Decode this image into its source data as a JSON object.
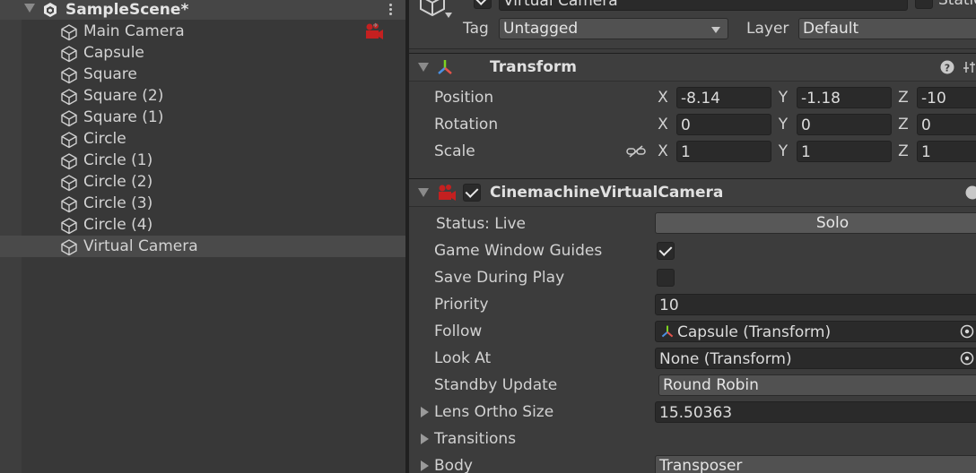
{
  "hierarchy": {
    "scene_name": "SampleScene*",
    "items": [
      {
        "label": "Main Camera",
        "icon": "cube-icon"
      },
      {
        "label": "Capsule",
        "icon": "cube-icon"
      },
      {
        "label": "Square",
        "icon": "cube-icon"
      },
      {
        "label": "Square (2)",
        "icon": "cube-icon"
      },
      {
        "label": "Square (1)",
        "icon": "cube-icon"
      },
      {
        "label": "Circle",
        "icon": "cube-icon"
      },
      {
        "label": "Circle (1)",
        "icon": "cube-icon"
      },
      {
        "label": "Circle (2)",
        "icon": "cube-icon"
      },
      {
        "label": "Circle (3)",
        "icon": "cube-icon"
      },
      {
        "label": "Circle (4)",
        "icon": "cube-icon"
      },
      {
        "label": "Virtual Camera",
        "icon": "cube-icon",
        "selected": true
      }
    ]
  },
  "inspector": {
    "object_name": "Virtual Camera",
    "static_label": "Static",
    "tag_label": "Tag",
    "tag_value": "Untagged",
    "layer_label": "Layer",
    "layer_value": "Default",
    "transform": {
      "title": "Transform",
      "position_label": "Position",
      "rotation_label": "Rotation",
      "scale_label": "Scale",
      "x": "X",
      "y": "Y",
      "z": "Z",
      "position": {
        "x": "-8.14",
        "y": "-1.18",
        "z": "-10"
      },
      "rotation": {
        "x": "0",
        "y": "0",
        "z": "0"
      },
      "scale": {
        "x": "1",
        "y": "1",
        "z": "1"
      }
    },
    "vcam": {
      "title": "CinemachineVirtualCamera",
      "status": "Status: Live",
      "solo": "Solo",
      "game_window_guides_label": "Game Window Guides",
      "game_window_guides": true,
      "save_during_play_label": "Save During Play",
      "save_during_play": false,
      "priority_label": "Priority",
      "priority": "10",
      "follow_label": "Follow",
      "follow": "Capsule (Transform)",
      "look_at_label": "Look At",
      "look_at": "None (Transform)",
      "standby_label": "Standby Update",
      "standby": "Round Robin",
      "lens_label": "Lens Ortho Size",
      "lens": "15.50363",
      "transitions_label": "Transitions",
      "body_label": "Body",
      "body": "Transposer"
    }
  },
  "colors": {
    "panel": "#383838",
    "inspector": "#3c3c3c",
    "field": "#2a2a2a",
    "camera_badge": "#c42020"
  }
}
